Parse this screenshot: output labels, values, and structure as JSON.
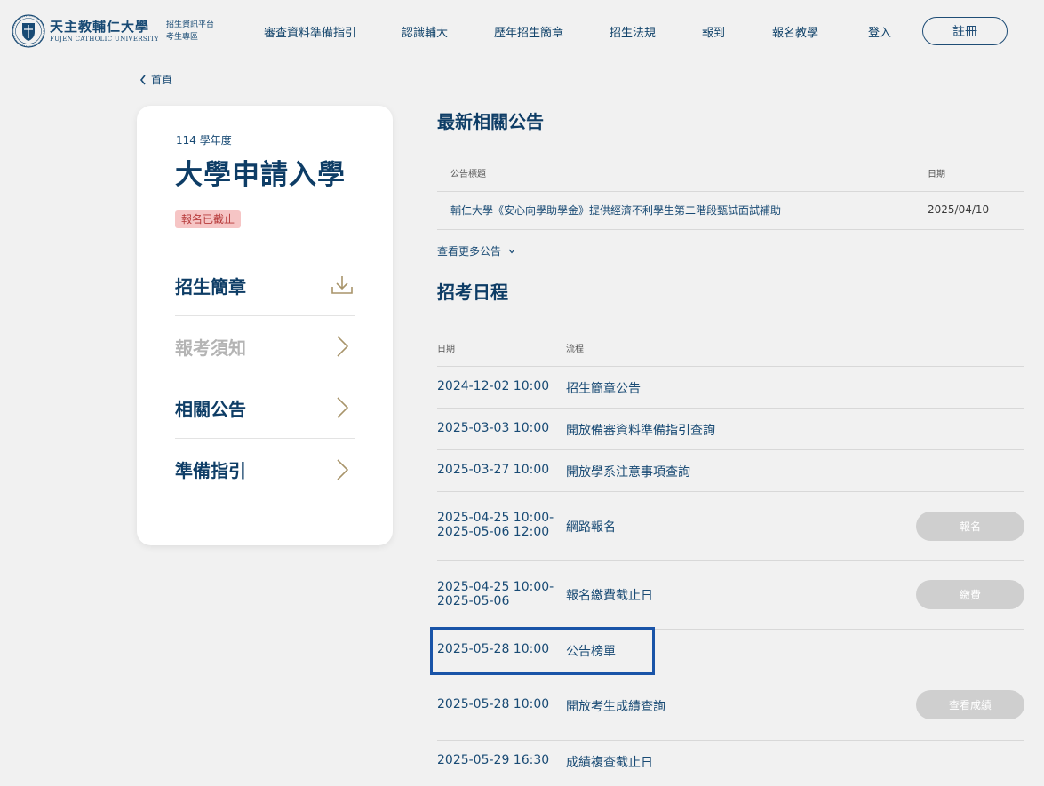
{
  "header": {
    "logo": {
      "name_zh": "天主教輔仁大學",
      "name_en": "FUJEN CATHOLIC UNIVERSITY",
      "sub_line1": "招生資訊平台",
      "sub_line2": "考生專區"
    },
    "nav": [
      "審查資料準備指引",
      "認識輔大",
      "歷年招生簡章",
      "招生法規",
      "報到",
      "報名教學",
      "登入"
    ],
    "register_label": "註冊"
  },
  "breadcrumb": {
    "home_label": "首頁"
  },
  "card": {
    "year_label": "114 學年度",
    "title": "大學申請入學",
    "status_badge": "報名已截止",
    "menu": [
      {
        "label": "招生簡章",
        "icon": "download-icon"
      },
      {
        "label": "報考須知",
        "icon": "chevron-right-icon"
      },
      {
        "label": "相關公告",
        "icon": "chevron-right-icon"
      },
      {
        "label": "準備指引",
        "icon": "chevron-right-icon"
      }
    ]
  },
  "announcements": {
    "title": "最新相關公告",
    "col_title": "公告標題",
    "col_date": "日期",
    "rows": [
      {
        "title": "輔仁大學《安心向學助學金》提供經濟不利學生第二階段甄試面試補助",
        "date": "2025/04/10"
      }
    ],
    "more_label": "查看更多公告"
  },
  "schedule": {
    "title": "招考日程",
    "col_date": "日期",
    "col_step": "流程",
    "rows": [
      {
        "date": "2024-12-02 10:00",
        "step": "招生簡章公告",
        "action": ""
      },
      {
        "date": "2025-03-03 10:00",
        "step": "開放備審資料準備指引查詢",
        "action": ""
      },
      {
        "date": "2025-03-27 10:00",
        "step": "開放學系注意事項查詢",
        "action": ""
      },
      {
        "date": "2025-04-25 10:00-\n2025-05-06 12:00",
        "step": "網路報名",
        "action": "報名"
      },
      {
        "date": "2025-04-25 10:00-\n2025-05-06",
        "step": "報名繳費截止日",
        "action": "繳費"
      },
      {
        "date": "2025-05-28 10:00",
        "step": "公告榜單",
        "action": ""
      },
      {
        "date": "2025-05-28 10:00",
        "step": "開放考生成績查詢",
        "action": "查看成績"
      },
      {
        "date": "2025-05-29 16:30",
        "step": "成績複查截止日",
        "action": ""
      }
    ]
  },
  "colors": {
    "primary": "#0e3d66",
    "badge_bg": "#f6c5c5",
    "badge_text": "#b63a3a",
    "icon_gold": "#a8946a",
    "highlight_border": "#1a54a8",
    "disabled_button": "#cfcfcf"
  }
}
